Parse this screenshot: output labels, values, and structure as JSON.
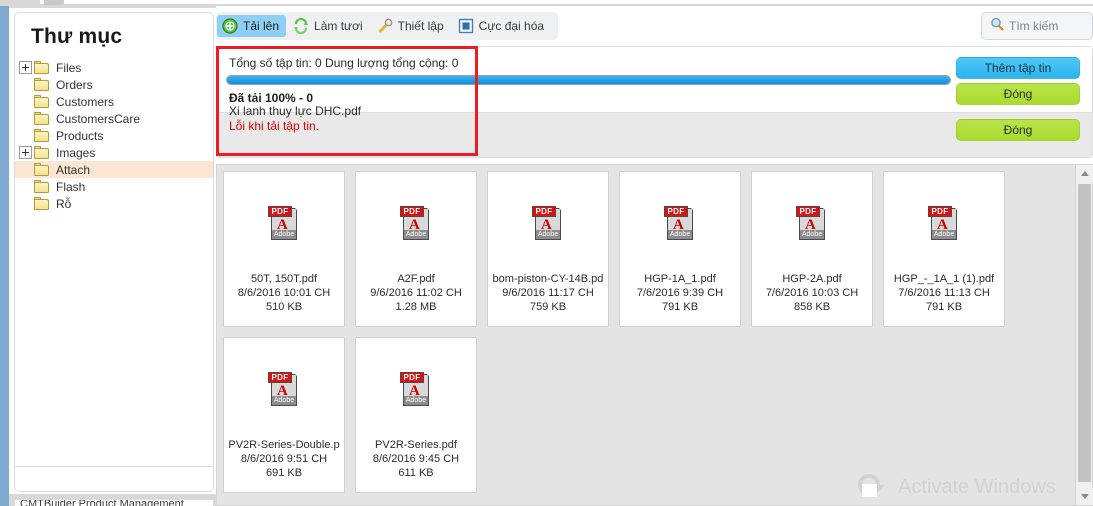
{
  "window": {
    "accent_blue": "#7fa8cd",
    "annotation_color": "#ec1b24"
  },
  "sidebar": {
    "title": "Thư mục",
    "items": [
      {
        "label": "Files",
        "expandable": true,
        "selected": false
      },
      {
        "label": "Orders",
        "expandable": false,
        "selected": false
      },
      {
        "label": "Customers",
        "expandable": false,
        "selected": false
      },
      {
        "label": "CustomersCare",
        "expandable": false,
        "selected": false
      },
      {
        "label": "Products",
        "expandable": false,
        "selected": false
      },
      {
        "label": "Images",
        "expandable": true,
        "selected": false
      },
      {
        "label": "Attach",
        "expandable": false,
        "selected": true
      },
      {
        "label": "Flash",
        "expandable": false,
        "selected": false
      },
      {
        "label": "Rỗ",
        "expandable": false,
        "selected": false
      }
    ],
    "bottom_clipped_text": "CMTBuider Product Management"
  },
  "toolbar": {
    "items": [
      {
        "label": "Tải lên",
        "icon": "upload-icon",
        "active": true
      },
      {
        "label": "Làm tươi",
        "icon": "refresh-icon",
        "active": false
      },
      {
        "label": "Thiết lập",
        "icon": "wrench-icon",
        "active": false
      },
      {
        "label": "Cực đại hóa",
        "icon": "maximize-icon",
        "active": false
      }
    ]
  },
  "search": {
    "placeholder": "Tìm kiếm",
    "value": ""
  },
  "upload_panel": {
    "summary": "Tổng số tập tin: 0 Dung lượng tổng cộng: 0",
    "progress_percent": 100,
    "progress_color": "#1e9ff2",
    "status": "Đã tải 100% - 0",
    "file_name": "Xi lanh thuy lực DHC.pdf",
    "error_message": "Lỗi khi tải tập tin.",
    "error_color": "#e00000",
    "buttons": {
      "add_files": "Thêm tập tin",
      "close_top": "Đóng",
      "close_bottom": "Đóng"
    }
  },
  "files": [
    {
      "name": "50T, 150T.pdf",
      "date": "8/6/2016 10:01 CH",
      "size": "510 KB",
      "icon": "pdf-icon"
    },
    {
      "name": "A2F.pdf",
      "date": "9/6/2016 11:02 CH",
      "size": "1.28 MB",
      "icon": "pdf-icon"
    },
    {
      "name": "bom-piston-CY-14B.pd",
      "date": "9/6/2016 11:17 CH",
      "size": "759 KB",
      "icon": "pdf-icon"
    },
    {
      "name": "HGP-1A_1.pdf",
      "date": "7/6/2016 9:39 CH",
      "size": "791 KB",
      "icon": "pdf-icon"
    },
    {
      "name": "HGP-2A.pdf",
      "date": "7/6/2016 10:03 CH",
      "size": "858 KB",
      "icon": "pdf-icon"
    },
    {
      "name": "HGP_-_1A_1 (1).pdf",
      "date": "7/6/2016 11:13 CH",
      "size": "791 KB",
      "icon": "pdf-icon"
    },
    {
      "name": "PV2R-Series-Double.p",
      "date": "8/6/2016 9:51 CH",
      "size": "691 KB",
      "icon": "pdf-icon"
    },
    {
      "name": "PV2R-Series.pdf",
      "date": "8/6/2016 9:45 CH",
      "size": "611 KB",
      "icon": "pdf-icon"
    }
  ],
  "pdf_icon": {
    "banner_text": "PDF",
    "brand_text": "Adobe",
    "glyph": "A"
  },
  "watermark": {
    "text": "Activate Windows"
  }
}
